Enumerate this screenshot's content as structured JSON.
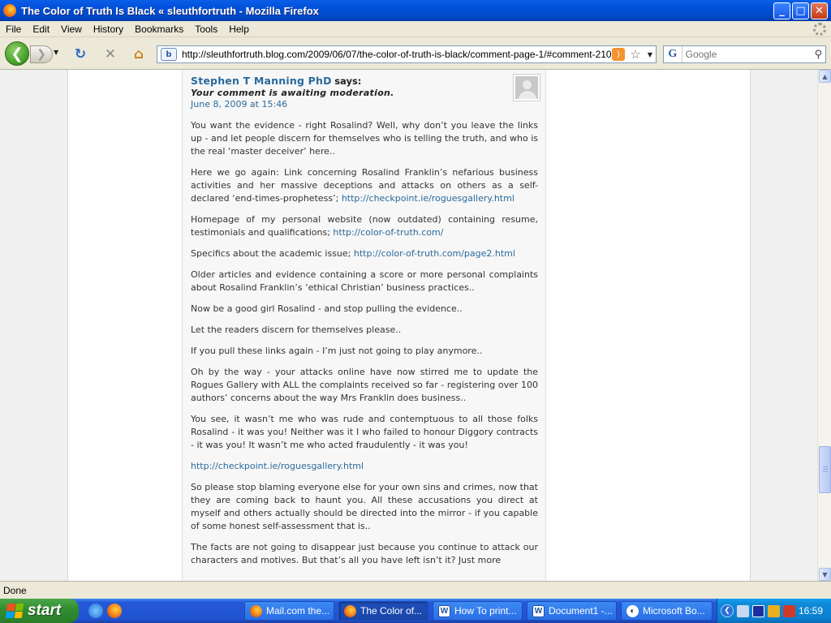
{
  "window": {
    "title": "The Color of Truth Is Black « sleuthfortruth - Mozilla Firefox",
    "minimize": "_",
    "maximize": "□",
    "close": "✕"
  },
  "menu": {
    "items": [
      "File",
      "Edit",
      "View",
      "History",
      "Bookmarks",
      "Tools",
      "Help"
    ]
  },
  "toolbar": {
    "back": "❮",
    "forward": "❯",
    "reload": "↻",
    "stop": "✕",
    "home": "⌂",
    "url": "http://sleuthfortruth.blog.com/2009/06/07/the-color-of-truth-is-black/comment-page-1/#comment-210",
    "search_placeholder": "Google",
    "search_engine": "G"
  },
  "comment": {
    "author": "Stephen T Manning PhD",
    "says": "says:",
    "moderation": "Your comment is awaiting moderation.",
    "date": "June 8, 2009 at 15:46",
    "p1": "You want the evidence - right Rosalind? Well, why don’t you leave the links up - and let people discern for themselves who is telling the truth, and who is the real ‘master deceiver’ here..",
    "p2_text": "Here we go again: Link concerning Rosalind Franklin’s nefarious business activities and her massive deceptions and attacks on others as a self-declared ‘end-times-prophetess’; ",
    "p2_link": "http://checkpoint.ie/roguesgallery.html",
    "p3_text": "Homepage of my personal website (now outdated) containing resume, testimonials and qualifications; ",
    "p3_link": "http://color-of-truth.com/",
    "p4_text": "Specifics about the academic issue; ",
    "p4_link": "http://color-of-truth.com/page2.html",
    "p5": "Older articles and evidence containing a score or more personal complaints about Rosalind Franklin’s ‘ethical Christian’ business practices..",
    "p6": "Now be a good girl Rosalind - and stop pulling the evidence..",
    "p7": "Let the readers discern for themselves please..",
    "p8": "If you pull these links again - I’m just not going to play anymore..",
    "p9": "Oh by the way - your attacks online have now stirred me to update the Rogues Gallery with ALL the complaints received so far - registering over 100 authors’ concerns about the way Mrs Franklin does business..",
    "p10": "You see, it wasn’t me who was rude and contemptuous to all those folks Rosalind - it was you! Neither was it I who failed to honour Diggory contracts - it was you! It wasn’t me who acted fraudulently - it was you!",
    "p11_link": "http://checkpoint.ie/roguesgallery.html",
    "p12": "So please stop blaming everyone else for your own sins and crimes, now that they are coming back to haunt you. All these accusations you direct at myself and others actually should be directed into the mirror - if you capable of some honest self-assessment that is..",
    "p13": "The facts are not going to disappear just because you continue to attack our characters and motives. But that’s all you have left isn’t it? Just more"
  },
  "status": {
    "text": "Done"
  },
  "taskbar": {
    "start": "start",
    "tasks": [
      "Mail.com the...",
      "The Color of...",
      "How To print...",
      "Document1 -...",
      "Microsoft Bo..."
    ],
    "clock": "16:59"
  }
}
